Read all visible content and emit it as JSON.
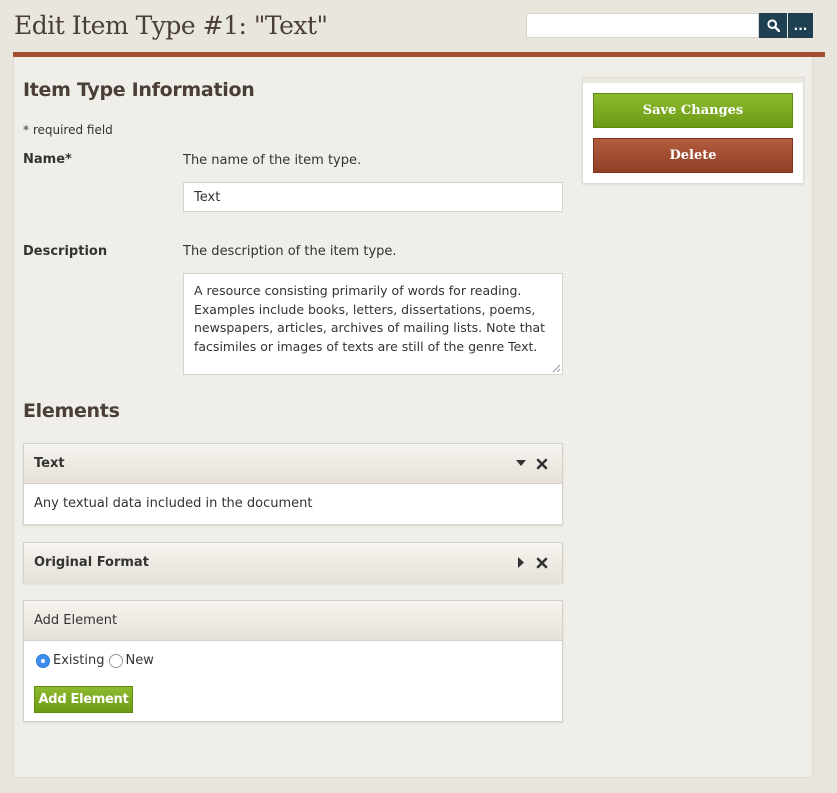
{
  "header": {
    "title": "Edit Item Type #1: \"Text\"",
    "search": {
      "value": "",
      "placeholder": ""
    },
    "advanced_search_label": "..."
  },
  "form": {
    "section_title": "Item Type Information",
    "required_note": "* required field",
    "name": {
      "label": "Name*",
      "hint": "The name of the item type.",
      "value": "Text"
    },
    "description": {
      "label": "Description",
      "hint": "The description of the item type.",
      "value": "A resource consisting primarily of words for reading. Examples include books, letters, dissertations, poems, newspapers, articles, archives of mailing lists. Note that facsimiles or images of texts are still of the genre Text."
    }
  },
  "elements": {
    "section_title": "Elements",
    "items": [
      {
        "title": "Text",
        "description": "Any textual data included in the document",
        "expanded": true
      },
      {
        "title": "Original Format",
        "expanded": false
      }
    ],
    "add_panel": {
      "title": "Add Element",
      "options": [
        "Existing",
        "New"
      ],
      "selected": "Existing",
      "button_label": "Add Element"
    }
  },
  "sidebar": {
    "save_label": "Save Changes",
    "delete_label": "Delete"
  },
  "colors": {
    "accent_rule": "#a14f30",
    "save": "#7aa91f",
    "delete": "#a14f30",
    "search_button": "#1e4052"
  }
}
